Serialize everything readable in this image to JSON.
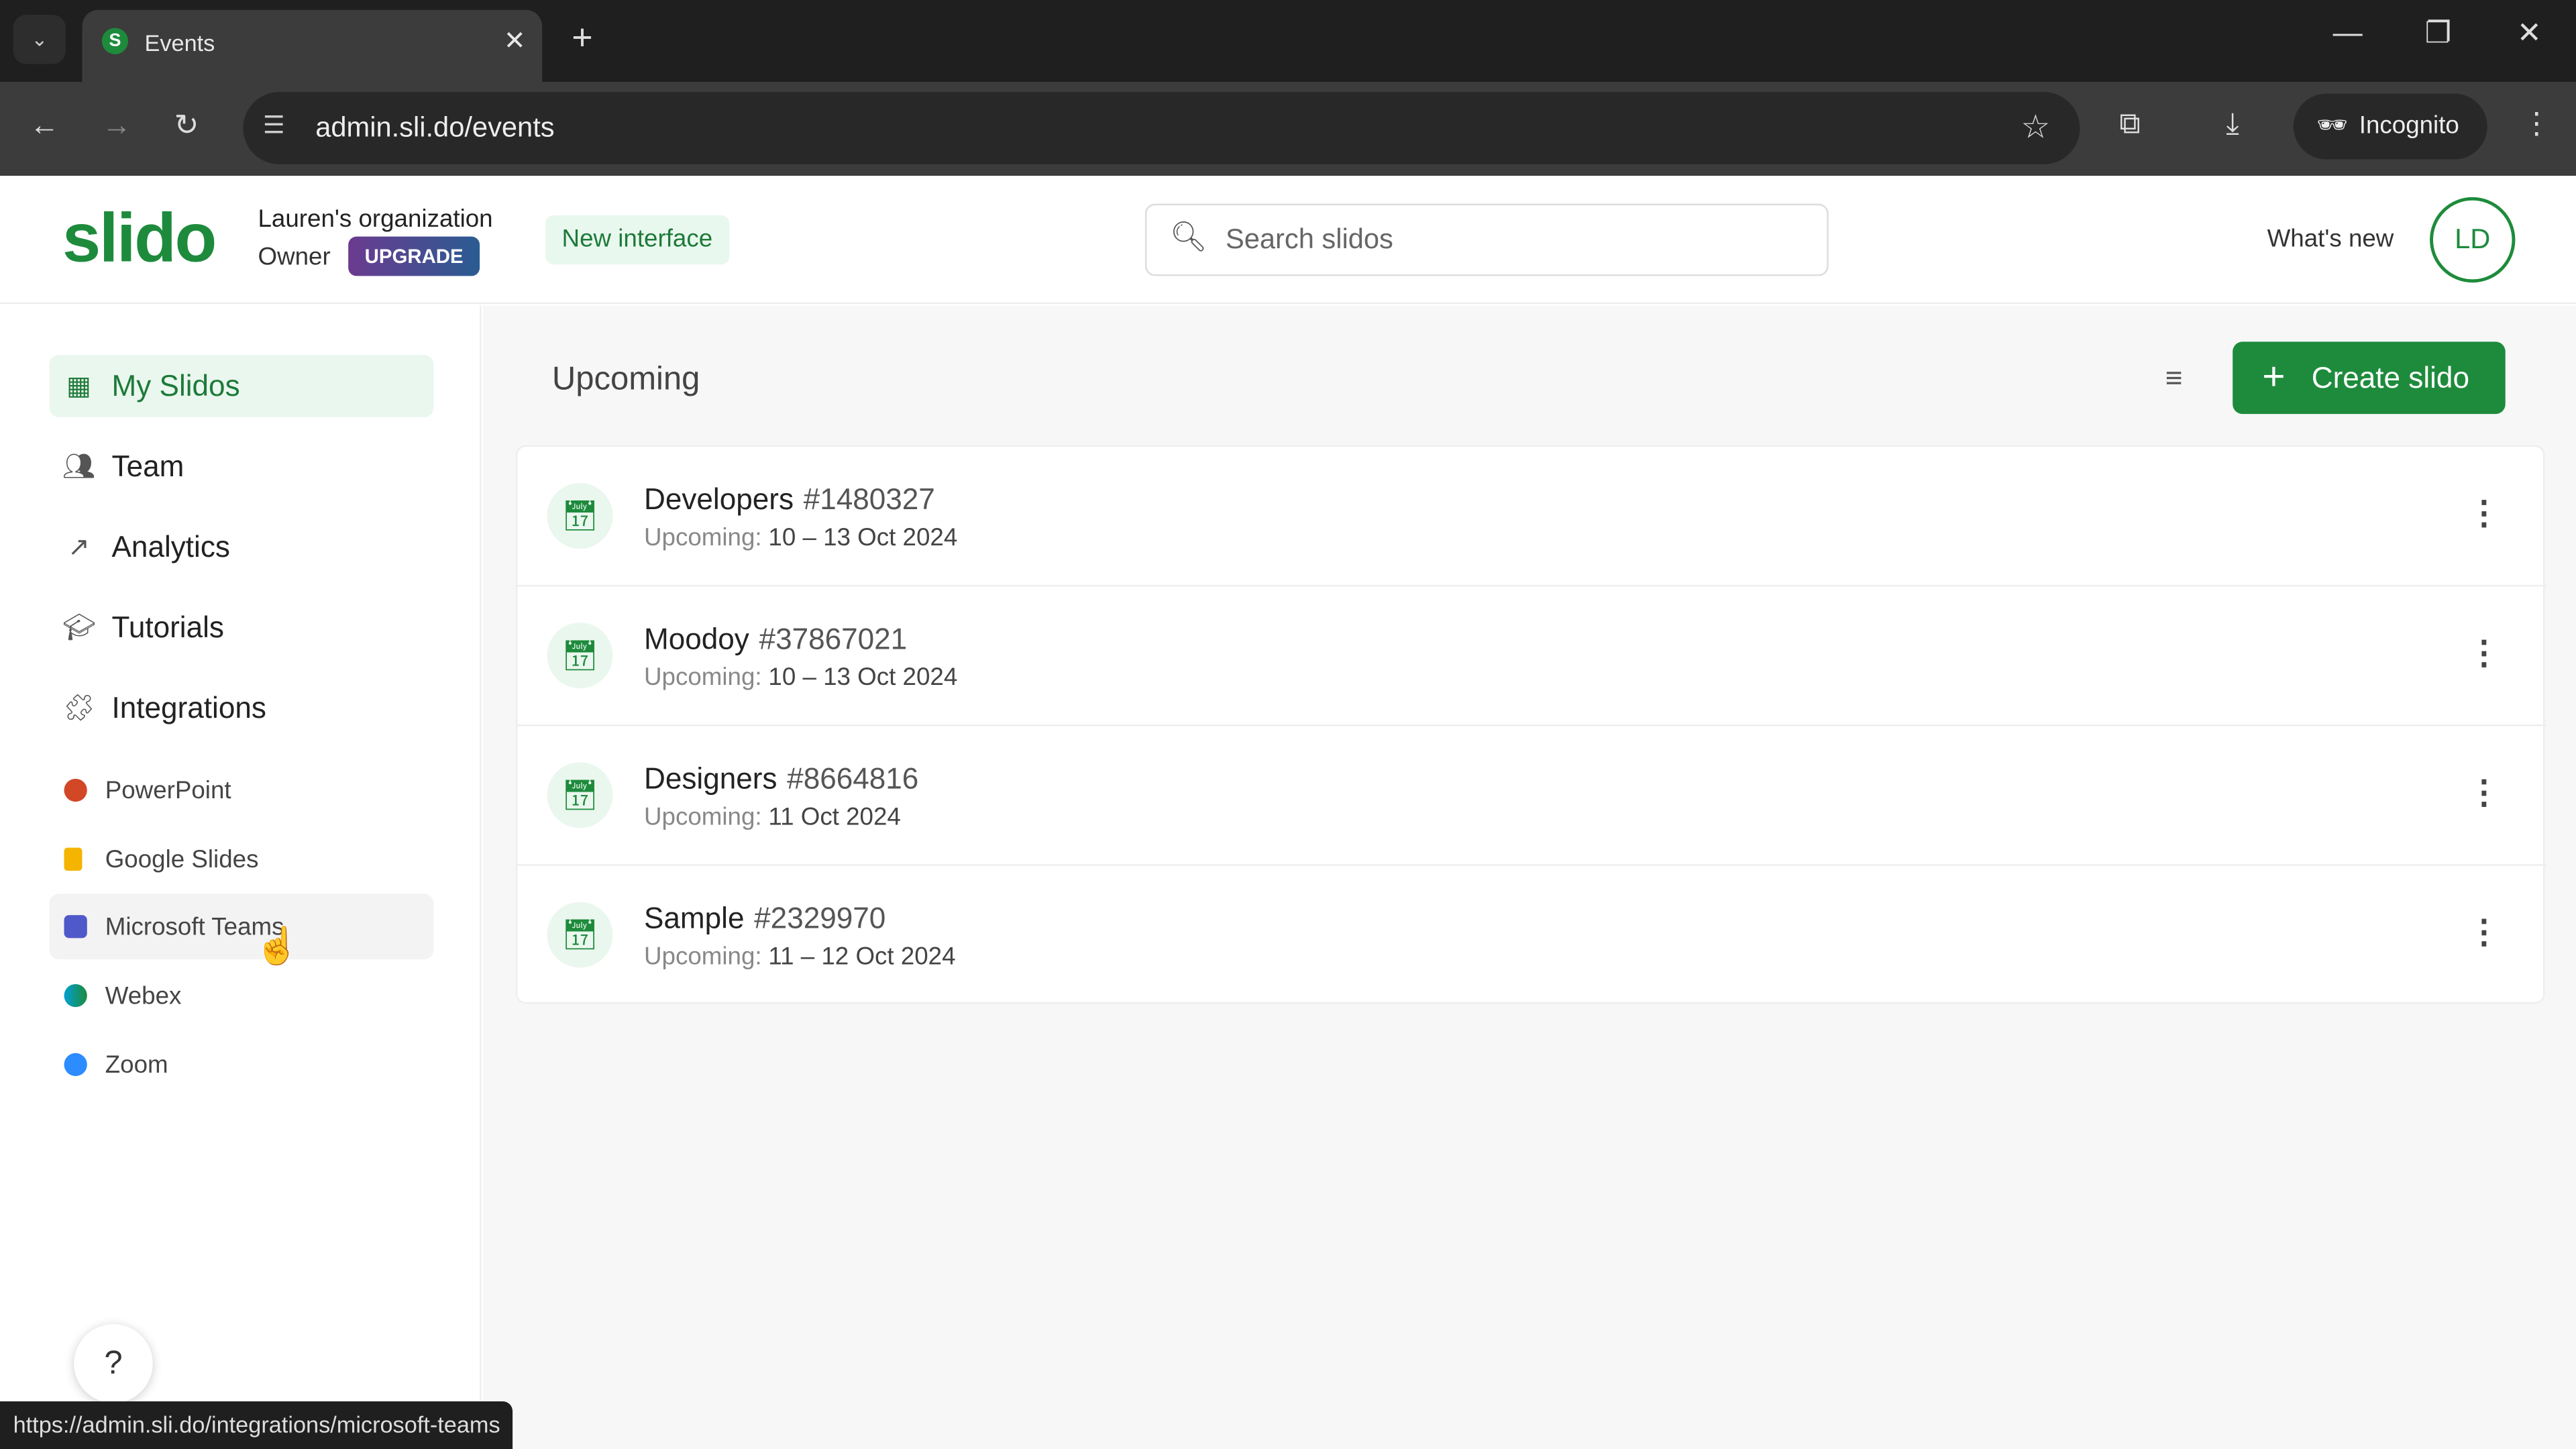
{
  "browser": {
    "tab_title": "Events",
    "url": "admin.sli.do/events",
    "profile": "Incognito",
    "status_url": "https://admin.sli.do/integrations/microsoft-teams"
  },
  "header": {
    "logo": "slido",
    "org_name": "Lauren's organization",
    "role": "Owner",
    "upgrade_label": "UPGRADE",
    "new_interface_label": "New interface",
    "search_placeholder": "Search slidos",
    "whats_new": "What's new",
    "avatar_initials": "LD"
  },
  "sidebar": {
    "items": [
      {
        "label": "My Slidos",
        "icon": "calendar-grid-icon",
        "active": true
      },
      {
        "label": "Team",
        "icon": "people-icon"
      },
      {
        "label": "Analytics",
        "icon": "trend-icon"
      },
      {
        "label": "Tutorials",
        "icon": "graduation-cap-icon"
      },
      {
        "label": "Integrations",
        "icon": "puzzle-icon"
      }
    ],
    "integrations": [
      {
        "label": "PowerPoint",
        "color": "#d24726"
      },
      {
        "label": "Google Slides",
        "color": "#f4b400"
      },
      {
        "label": "Microsoft Teams",
        "color": "#5059c9"
      },
      {
        "label": "Webex",
        "color": "#00a0d1"
      },
      {
        "label": "Zoom",
        "color": "#2d8cff"
      }
    ],
    "help_label": "?"
  },
  "main": {
    "section_title": "Upcoming",
    "create_label": "Create slido",
    "events": [
      {
        "name": "Developers",
        "code": "#1480327",
        "status": "Upcoming:",
        "dates": "10 – 13 Oct 2024"
      },
      {
        "name": "Moodoy",
        "code": "#37867021",
        "status": "Upcoming:",
        "dates": "10 – 13 Oct 2024"
      },
      {
        "name": "Designers",
        "code": "#8664816",
        "status": "Upcoming:",
        "dates": "11 Oct 2024"
      },
      {
        "name": "Sample",
        "code": "#2329970",
        "status": "Upcoming:",
        "dates": "11 – 12 Oct 2024"
      }
    ]
  },
  "colors": {
    "brand": "#1e8b3c",
    "brand_light": "#eaf7ee"
  }
}
